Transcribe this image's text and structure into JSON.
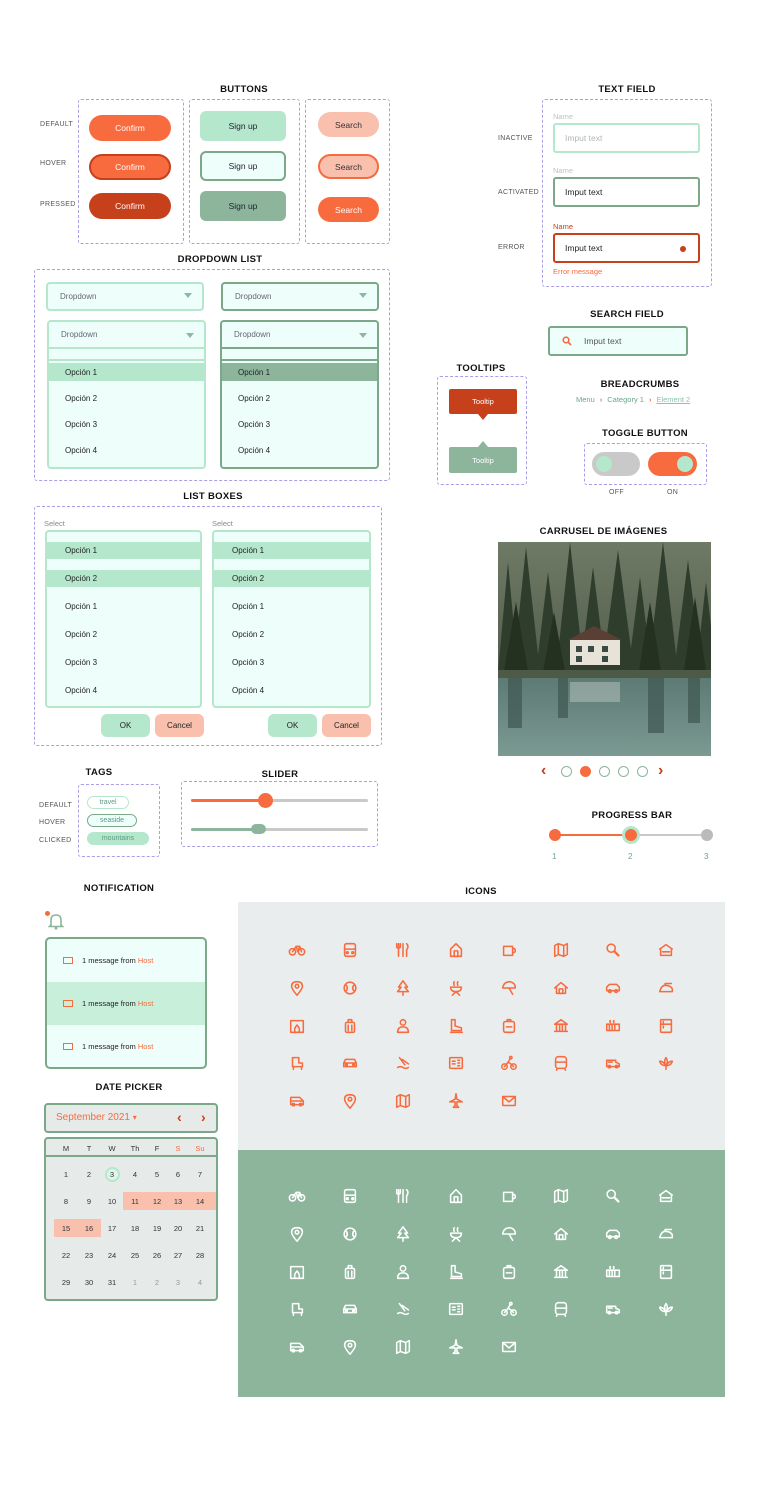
{
  "colors": {
    "accent": "#f76b3e",
    "accent_dark": "#c6401c",
    "mint": "#b5e7cd",
    "mint_light": "#eefefb",
    "sage": "#8cb59b",
    "salmon": "#f8c0ad",
    "dashed_border": "#a99ee9"
  },
  "buttons": {
    "title": "BUTTONS",
    "states": [
      "DEFAULT",
      "HOVER",
      "PRESSED"
    ],
    "confirm": [
      "Confirm",
      "Confirm",
      "Confirm"
    ],
    "signup": [
      "Sign up",
      "Sign up",
      "Sign up"
    ],
    "search": [
      "Search",
      "Search",
      "Search"
    ]
  },
  "text_field": {
    "title": "TEXT FIELD",
    "states": [
      "INACTIVE",
      "ACTIVATED",
      "ERROR"
    ],
    "labels": [
      "Name",
      "Name",
      "Name"
    ],
    "values": [
      "Imput text",
      "Imput text",
      "Imput text"
    ],
    "error_message": "Error message"
  },
  "dropdown": {
    "title": "DROPDOWN LIST",
    "closed_labels": [
      "Dropdown",
      "Dropdown"
    ],
    "open_labels": [
      "Dropdown",
      "Dropdown"
    ],
    "options": [
      "Opción 1",
      "Opción 2",
      "Opción 3",
      "Opción 4"
    ]
  },
  "search_field": {
    "title": "SEARCH FIELD",
    "placeholder": "Imput text",
    "icon": "search-icon"
  },
  "tooltips": {
    "title": "TOOLTIPS",
    "items": [
      "Tooltip",
      "Tooltip"
    ]
  },
  "breadcrumbs": {
    "title": "BREADCRUMBS",
    "items": [
      "Menu",
      "Category 1",
      "Element 2"
    ]
  },
  "toggle": {
    "title": "TOGGLE BUTTON",
    "off_label": "OFF",
    "on_label": "ON"
  },
  "list_boxes": {
    "title": "LIST BOXES",
    "select_label": "Select",
    "selected": [
      "Opción 1",
      "Opción 2"
    ],
    "options": [
      "Opción 1",
      "Opción 2",
      "Opción 3",
      "Opción 4"
    ],
    "ok": "OK",
    "cancel": "Cancel"
  },
  "carousel": {
    "title": "CARRUSEL DE IMÁGENES",
    "slide_count": 5,
    "active_index": 1
  },
  "tags": {
    "title": "TAGS",
    "states": [
      "DEFAULT",
      "HOVER",
      "CLICKED"
    ],
    "items": [
      "travel",
      "seaside",
      "mountains"
    ]
  },
  "slider": {
    "title": "SLIDER",
    "values": [
      0.42,
      0.38
    ]
  },
  "progress": {
    "title": "PROGRESS BAR",
    "steps": [
      "1",
      "2",
      "3"
    ],
    "current_step": 2
  },
  "notification": {
    "title": "NOTIFICATION",
    "message_prefix": "1 message from",
    "message_sender": "Host",
    "count": 3
  },
  "icons": {
    "title": "ICONS",
    "names": [
      "bicycle-icon",
      "bus-icon",
      "restaurant-icon",
      "house-icon",
      "coffee-icon",
      "map-icon",
      "search-icon",
      "store-icon",
      "location-pin-icon",
      "tennis-ball-icon",
      "tree-icon",
      "barbecue-icon",
      "umbrella-icon",
      "home-icon",
      "car-side-icon",
      "iron-icon",
      "fireplace-icon",
      "luggage-icon",
      "person-icon",
      "ice-skate-icon",
      "backpack-icon",
      "museum-icon",
      "heater-icon",
      "fridge-icon",
      "armchair-icon",
      "car-icon",
      "beach-icon",
      "document-icon",
      "cyclist-icon",
      "train-icon",
      "camper-icon",
      "lotus-icon",
      "van-icon",
      "pin-icon",
      "folded-map-icon",
      "airplane-icon",
      "mail-icon"
    ]
  },
  "date_picker": {
    "title": "DATE PICKER",
    "month": "September 2021",
    "weekdays": [
      "M",
      "T",
      "W",
      "Th",
      "F",
      "S",
      "Su"
    ],
    "weeks": [
      [
        "1",
        "2",
        "3",
        "4",
        "5",
        "6",
        "7"
      ],
      [
        "8",
        "9",
        "10",
        "11",
        "12",
        "13",
        "14"
      ],
      [
        "15",
        "16",
        "17",
        "18",
        "19",
        "20",
        "21"
      ],
      [
        "22",
        "23",
        "24",
        "25",
        "26",
        "27",
        "28"
      ],
      [
        "29",
        "30",
        "31",
        "1",
        "2",
        "3",
        "4"
      ]
    ],
    "today": "3",
    "highlighted": [
      "11",
      "12",
      "13",
      "14",
      "15",
      "16"
    ]
  }
}
